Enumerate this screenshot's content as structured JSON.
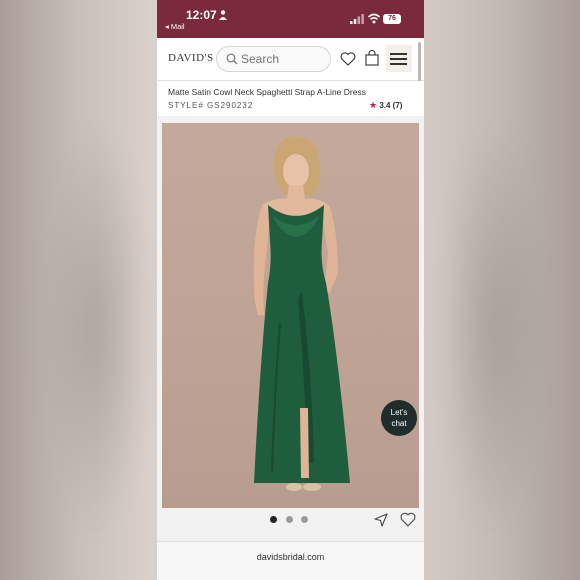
{
  "status_bar": {
    "time": "12:07",
    "back_app": "◂ Mail",
    "battery": "76"
  },
  "header": {
    "logo": "DAVID'S",
    "search_placeholder": "Search"
  },
  "product": {
    "title": "Matte Satin Cowl Neck Spaghetti Strap A-Line Dress",
    "style": "STYLE# GS290232",
    "rating": "3.4",
    "review_count": "(7)"
  },
  "chat": {
    "line1": "Let's",
    "line2": "chat"
  },
  "gallery": {
    "dot_count": 3,
    "active_index": 0
  },
  "browser": {
    "url": "davidsbridal.com"
  },
  "colors": {
    "status_bar": "#7a2a3a",
    "dress": "#1f5e3d",
    "star": "#c2185b",
    "chat": "#1f2d2b"
  }
}
